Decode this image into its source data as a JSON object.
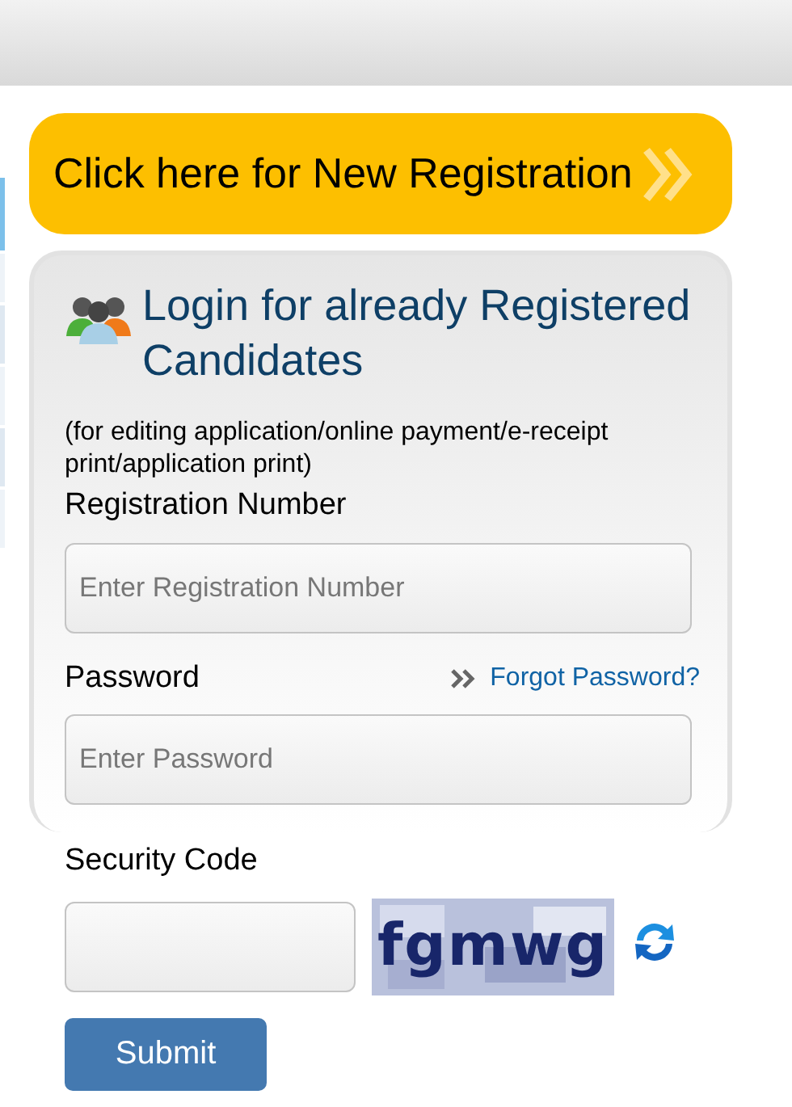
{
  "new_registration": {
    "label": "Click here for New Registration"
  },
  "login": {
    "title": "Login for already Registered Candidates",
    "note": "(for editing application/online payment/e-receipt print/application print)",
    "fields": [
      {
        "label": "Registration Number",
        "placeholder": "Enter Registration Number"
      },
      {
        "label": "Password",
        "placeholder": "Enter Password",
        "link": "Forgot Password?"
      }
    ]
  },
  "security": {
    "label": "Security Code",
    "captcha": "fgmwg"
  },
  "submit": {
    "label": "Submit"
  }
}
